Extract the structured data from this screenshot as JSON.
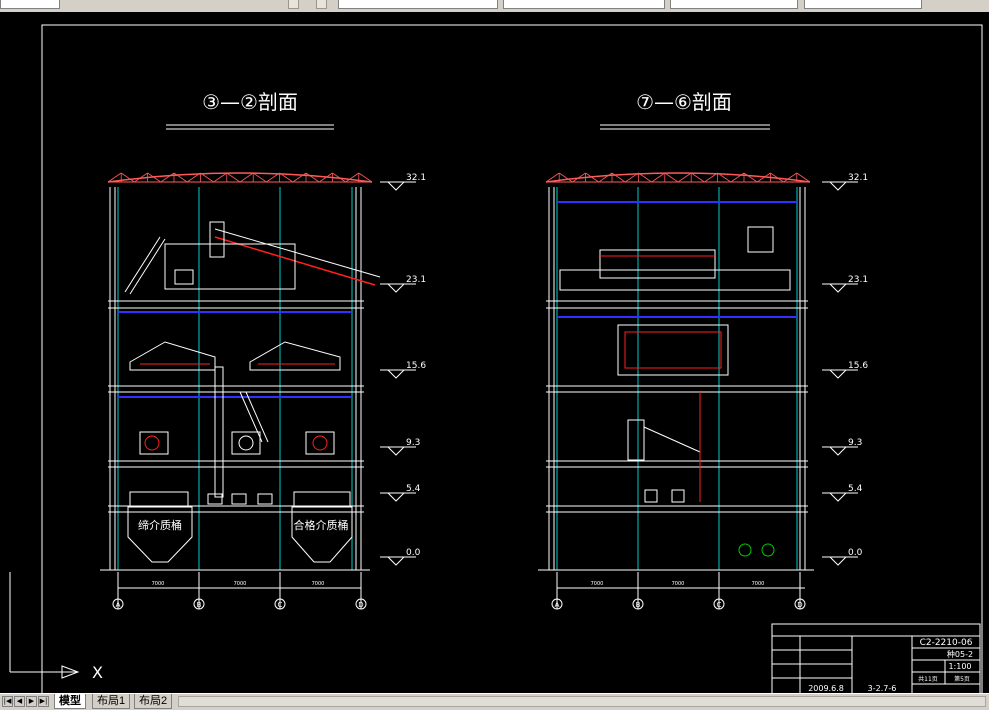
{
  "toolbar": {
    "layer_field": "",
    "color_field": "",
    "linetype_field": "",
    "lineweight_field": "",
    "plotstyle_field": ""
  },
  "drawing": {
    "left_section": {
      "title": "③—②剖面",
      "bin_left": "缔介质桶",
      "bin_right": "合格介质桶",
      "grid": [
        "A",
        "B",
        "C",
        "D"
      ],
      "span_dim": "7000"
    },
    "right_section": {
      "title": "⑦—⑥剖面",
      "grid": [
        "A",
        "B",
        "C",
        "D"
      ],
      "span_dim": "7000"
    },
    "elevations": [
      "32.1",
      "23.1",
      "15.6",
      "9.3",
      "5.4",
      "0.0"
    ],
    "ucs_x": "X",
    "title_block": {
      "drawing_no": "C2-2210-06",
      "sheet_code": "种05-2",
      "scale": "1:100",
      "sheet_count": "共11页",
      "sheet_index": "第5页",
      "date": "2009.6.8",
      "ref": "3-2.7-6"
    }
  },
  "tabs": [
    {
      "label": "模型",
      "active": true
    },
    {
      "label": "布局1",
      "active": false
    },
    {
      "label": "布局2",
      "active": false
    }
  ],
  "colors": {
    "background": "#000000",
    "roof": "#ff5a5a",
    "cyan": "#00cccc",
    "blue": "#3030ff",
    "white": "#ffffff",
    "red": "#ff2020"
  }
}
